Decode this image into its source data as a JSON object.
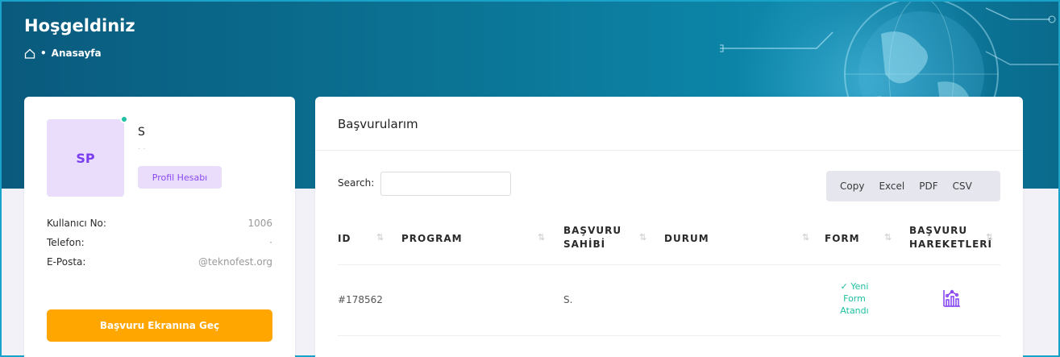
{
  "header": {
    "title": "Hoşgeldiniz",
    "breadcrumb": {
      "home_icon": "home-icon",
      "separator": "•",
      "current": "Anasayfa"
    }
  },
  "profile": {
    "initials": "SP",
    "name": "S",
    "subtitle": "· ·",
    "badge": "Profil Hesabı",
    "online_color": "#1fc0a2",
    "fields": [
      {
        "label": "Kullanıcı No:",
        "value": "1006"
      },
      {
        "label": "Telefon:",
        "value": "·"
      },
      {
        "label": "E-Posta:",
        "value": "@teknofest.org"
      }
    ],
    "button_label": "Başvuru Ekranına Geç",
    "button_color": "#ffa600"
  },
  "applications": {
    "title": "Başvurularım",
    "search_label": "Search:",
    "search_value": "",
    "export_buttons": [
      "Copy",
      "Excel",
      "PDF",
      "CSV"
    ],
    "sort_icon": "⇅",
    "columns": [
      {
        "label": "ID"
      },
      {
        "label": "PROGRAM"
      },
      {
        "label": "BAŞVURU SAHİBİ"
      },
      {
        "label": "DURUM"
      },
      {
        "label": "FORM"
      },
      {
        "label": "BAŞVURU HAREKETLERİ"
      }
    ],
    "rows": [
      {
        "id": "#178562",
        "program": "",
        "owner": "S.",
        "status": "",
        "form_status": "✓ Yeni Form Atandı",
        "action_icon": "chart-history-icon"
      }
    ],
    "accent_color": "#1fc0a2",
    "icon_color": "#8a4af3"
  }
}
